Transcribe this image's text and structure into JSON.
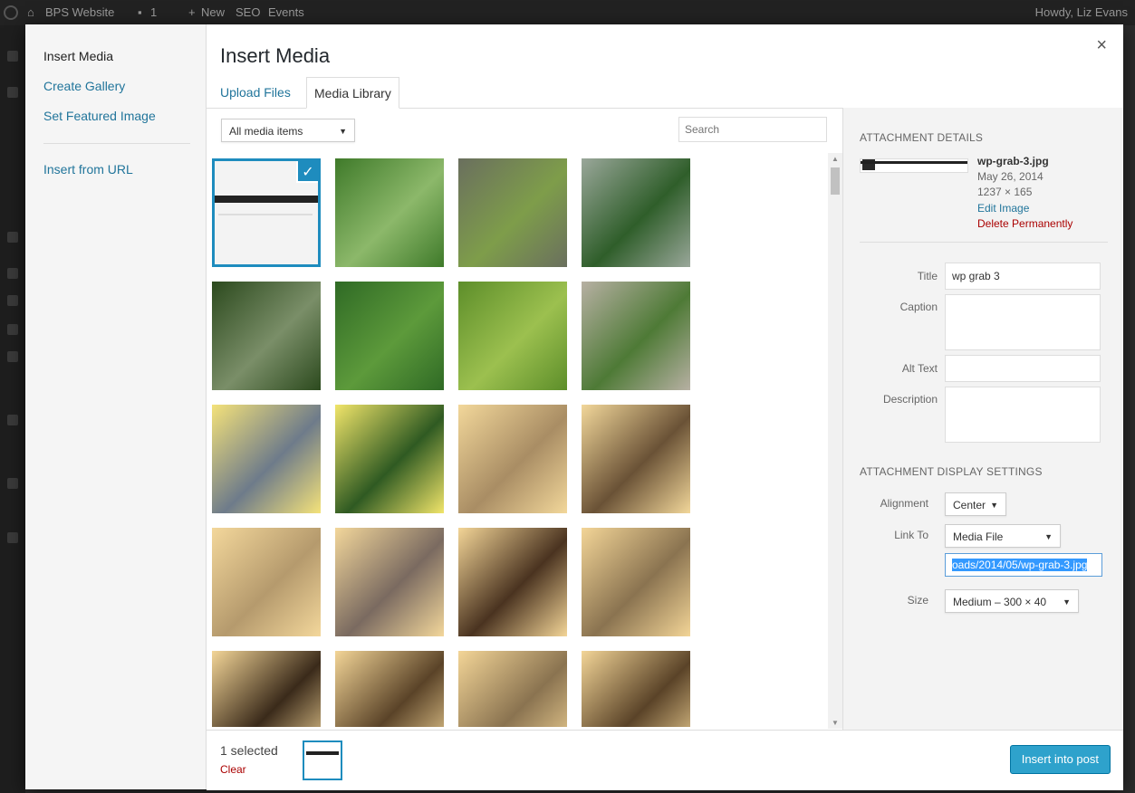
{
  "admin_bar": {
    "site_name": "BPS Website",
    "comments_count": "1",
    "new_label": "New",
    "seo_label": "SEO",
    "events_label": "Events",
    "greeting": "Howdy, Liz Evans"
  },
  "modal": {
    "title": "Insert Media",
    "close_icon": "×",
    "menu": [
      "Insert Media",
      "Create Gallery",
      "Set Featured Image",
      "Insert from URL"
    ],
    "tabs": [
      "Upload Files",
      "Media Library"
    ],
    "active_tab": "Media Library",
    "filter": {
      "selected": "All media items"
    },
    "search": {
      "placeholder": "Search"
    }
  },
  "media_items": [
    {
      "name": "wp-grab-3",
      "colors": [
        "#f3f3f3",
        "#222222"
      ],
      "selected": true
    },
    {
      "name": "fern-1",
      "colors": [
        "#3f7a2a",
        "#8cb86a"
      ]
    },
    {
      "name": "fern-rocks",
      "colors": [
        "#6a6f5e",
        "#7e9d4a"
      ]
    },
    {
      "name": "greenhouse",
      "colors": [
        "#9aa79a",
        "#2f5e2a"
      ]
    },
    {
      "name": "garden-1",
      "colors": [
        "#2c4a1e",
        "#7a8e68"
      ]
    },
    {
      "name": "garden-2",
      "colors": [
        "#2f6a25",
        "#5d9a3b"
      ]
    },
    {
      "name": "garden-path",
      "colors": [
        "#5d8e2a",
        "#9cc04f"
      ]
    },
    {
      "name": "rock-garden",
      "colors": [
        "#b7b0a3",
        "#4e7a36"
      ]
    },
    {
      "name": "fern-magazine-1",
      "colors": [
        "#f4e27a",
        "#6e7b8a"
      ]
    },
    {
      "name": "fern-magazine-2",
      "colors": [
        "#f1e56a",
        "#2f5a22"
      ]
    },
    {
      "name": "pteridologist-1",
      "colors": [
        "#f2d79a",
        "#a98d64"
      ]
    },
    {
      "name": "pteridologist-2",
      "colors": [
        "#f2d79a",
        "#6a5236"
      ]
    },
    {
      "name": "pteridologist-3",
      "colors": [
        "#f3d79b",
        "#b59a6d"
      ]
    },
    {
      "name": "pteridologist-4",
      "colors": [
        "#f3d79b",
        "#7a6a60"
      ]
    },
    {
      "name": "pteridologist-5",
      "colors": [
        "#f3d597",
        "#4a3320"
      ]
    },
    {
      "name": "pteridologist-6",
      "colors": [
        "#f3d597",
        "#8a7350"
      ]
    },
    {
      "name": "pteridologist-7",
      "colors": [
        "#f3d597",
        "#3a2a1a"
      ]
    },
    {
      "name": "pteridologist-8",
      "colors": [
        "#f3d597",
        "#5a4328"
      ]
    },
    {
      "name": "pteridologist-9",
      "colors": [
        "#f3d597",
        "#8a7350"
      ]
    },
    {
      "name": "pteridologist-10",
      "colors": [
        "#f3d597",
        "#5a4328"
      ]
    }
  ],
  "attachment": {
    "section_title": "ATTACHMENT DETAILS",
    "filename": "wp-grab-3.jpg",
    "date": "May 26, 2014",
    "dimensions": "1237 × 165",
    "edit_link": "Edit Image",
    "delete_link": "Delete Permanently",
    "fields": {
      "title_label": "Title",
      "title_value": "wp grab 3",
      "caption_label": "Caption",
      "alt_label": "Alt Text",
      "description_label": "Description"
    }
  },
  "display_settings": {
    "section_title": "ATTACHMENT DISPLAY SETTINGS",
    "alignment_label": "Alignment",
    "alignment_value": "Center",
    "link_label": "Link To",
    "link_value": "Media File",
    "url_value": "oads/2014/05/wp-grab-3.jpg",
    "size_label": "Size",
    "size_value": "Medium – 300 × 40"
  },
  "footer": {
    "selected_count": "1 selected",
    "clear_label": "Clear",
    "insert_label": "Insert into post"
  }
}
